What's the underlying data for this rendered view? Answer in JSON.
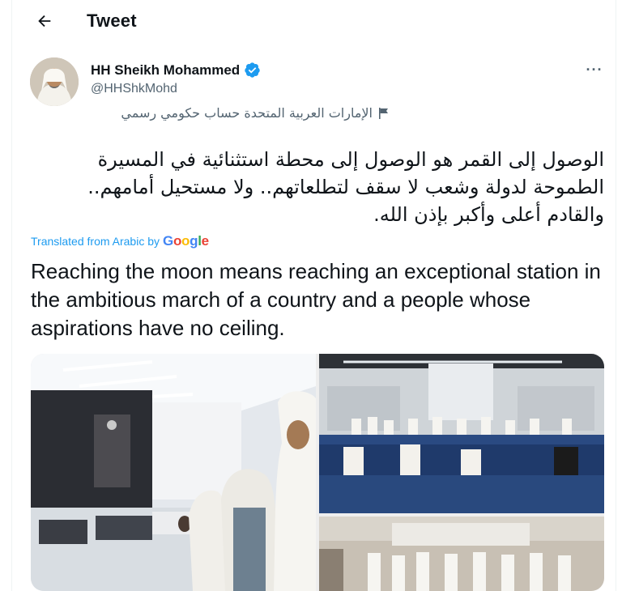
{
  "header": {
    "title": "Tweet",
    "back_icon": "arrow-left-icon"
  },
  "tweet": {
    "author": {
      "display_name": "HH Sheikh Mohammed",
      "handle": "@HHShkMohd",
      "verified": true,
      "label": "الإمارات العربية المتحدة حساب حكومي رسمي"
    },
    "text_original": "الوصول إلى القمر هو الوصول إلى محطة استثنائية في المسيرة الطموحة لدولة وشعب لا سقف لتطلعاتهم.. ولا مستحيل أمامهم.. والقادم أعلى وأكبر بإذن الله.",
    "translation": {
      "label": "Translated from Arabic by",
      "provider": "Google",
      "text": "Reaching the moon means reaching an exceptional station in the ambitious march of a country and a people whose aspirations have no ceiling."
    },
    "more_icon": "more-dots-icon"
  },
  "colors": {
    "accent": "#1d9bf0",
    "secondary_text": "#536471",
    "primary_text": "#0f1419"
  }
}
